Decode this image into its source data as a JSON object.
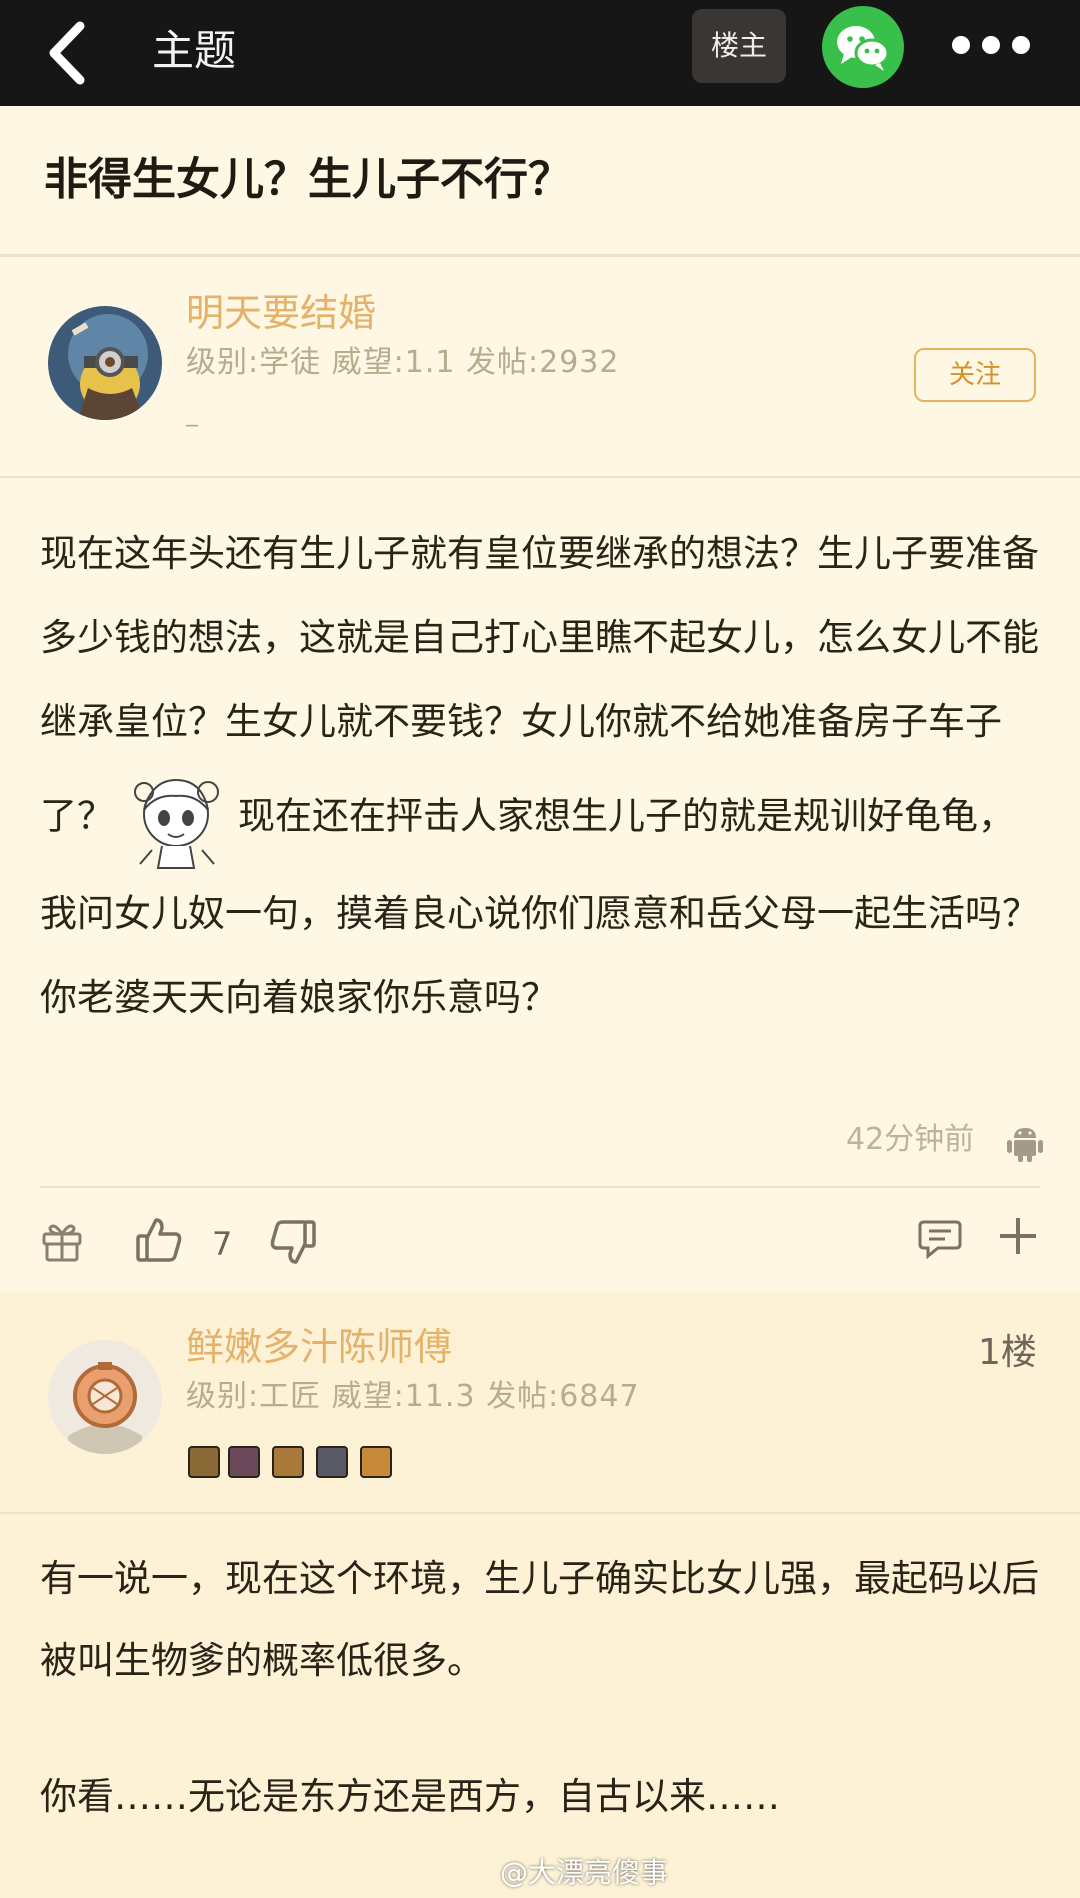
{
  "topbar": {
    "title": "主题",
    "louzhu_label": "楼主"
  },
  "thread": {
    "title": "非得生女儿？生儿子不行？"
  },
  "op": {
    "username": "明天要结婚",
    "meta": "级别:学徒 威望:1.1 发帖:2932",
    "signature": "_",
    "follow_label": "关注",
    "content_line1": "现在这年头还有生儿子就有皇位要继承的想法？生儿子要准备多少钱的想法，这就是自己打心里瞧不起女儿，怎么女儿不能继承皇位？生女儿就不要钱？女儿你就不",
    "content_line2_before": "给她准备房子车子了？",
    "content_line2_after": "现在还在抨击人家想生儿子的就是规训好龟龟，我问女儿奴一句，摸着良心说你们愿意和岳父母一起生活吗？你老婆天天向着娘家你乐意吗？",
    "time": "42分钟前",
    "like_count": "7"
  },
  "reply1": {
    "username": "鲜嫩多汁陈师傅",
    "meta": "级别:工匠 威望:11.3 发帖:6847",
    "floor": "1楼",
    "para1": "有一说一，现在这个环境，生儿子确实比女儿强，最起码以后被叫生物爹的概率低很多。",
    "para2": "你看……无论是东方还是西方，自古以来……"
  },
  "watermark": "@大漂亮傻事",
  "colors": {
    "background": "#fdf7e3",
    "topbar": "#161616",
    "username": "#e4b26a",
    "wechat": "#39c04a",
    "follow_border": "#e6b35b"
  }
}
